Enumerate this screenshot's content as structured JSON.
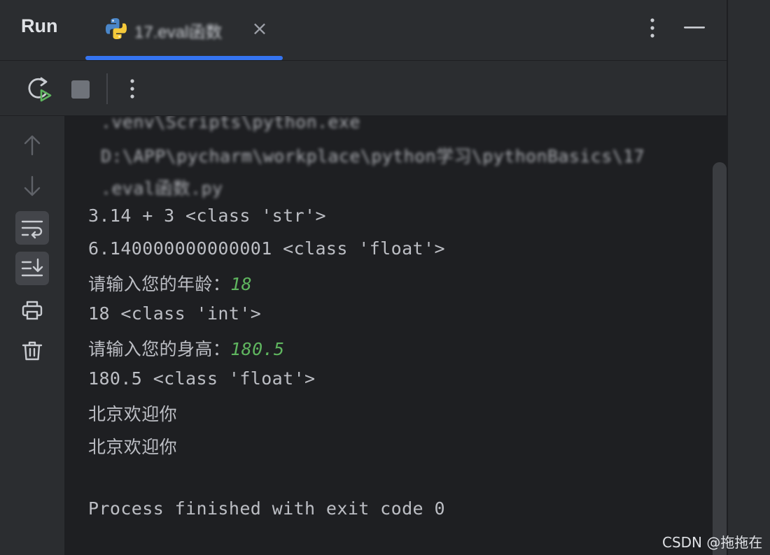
{
  "header": {
    "title": "Run",
    "tab": {
      "label": "17.eval函数",
      "icon": "python-file-icon"
    },
    "close_glyph": "×"
  },
  "toolbar": {
    "rerun_icon": "rerun-icon",
    "stop_icon": "stop-icon",
    "more_icon": "more-vertical-icon"
  },
  "gutter": {
    "buttons": [
      {
        "name": "scroll-up-icon",
        "active": false
      },
      {
        "name": "scroll-down-icon",
        "active": false
      },
      {
        "name": "soft-wrap-icon",
        "active": true
      },
      {
        "name": "scroll-to-end-icon",
        "active": true
      },
      {
        "name": "print-icon",
        "active": false
      },
      {
        "name": "trash-icon",
        "active": false
      }
    ]
  },
  "console": {
    "path_lines": [
      ".venv\\Scripts\\python.exe",
      "D:\\APP\\pycharm\\workplace\\python学习\\pythonBasics\\17",
      ".eval函数.py"
    ],
    "output": [
      {
        "text": "3.14 + 3 <class 'str'>"
      },
      {
        "text": "6.140000000000001 <class 'float'>"
      },
      {
        "prompt": "请输入您的年龄：",
        "input": "18"
      },
      {
        "text": "18 <class 'int'>"
      },
      {
        "prompt": "请输入您的身高：",
        "input": "180.5"
      },
      {
        "text": "180.5 <class 'float'>"
      },
      {
        "cn": "北京欢迎你"
      },
      {
        "cn": "北京欢迎你"
      },
      {
        "text": ""
      },
      {
        "text": "Process finished with exit code 0"
      }
    ]
  },
  "watermark": "CSDN @拖拖在",
  "colors": {
    "accent": "#3574f0",
    "input": "#5fb55f",
    "console_bg": "#1e1f22",
    "panel_bg": "#2b2d30"
  }
}
